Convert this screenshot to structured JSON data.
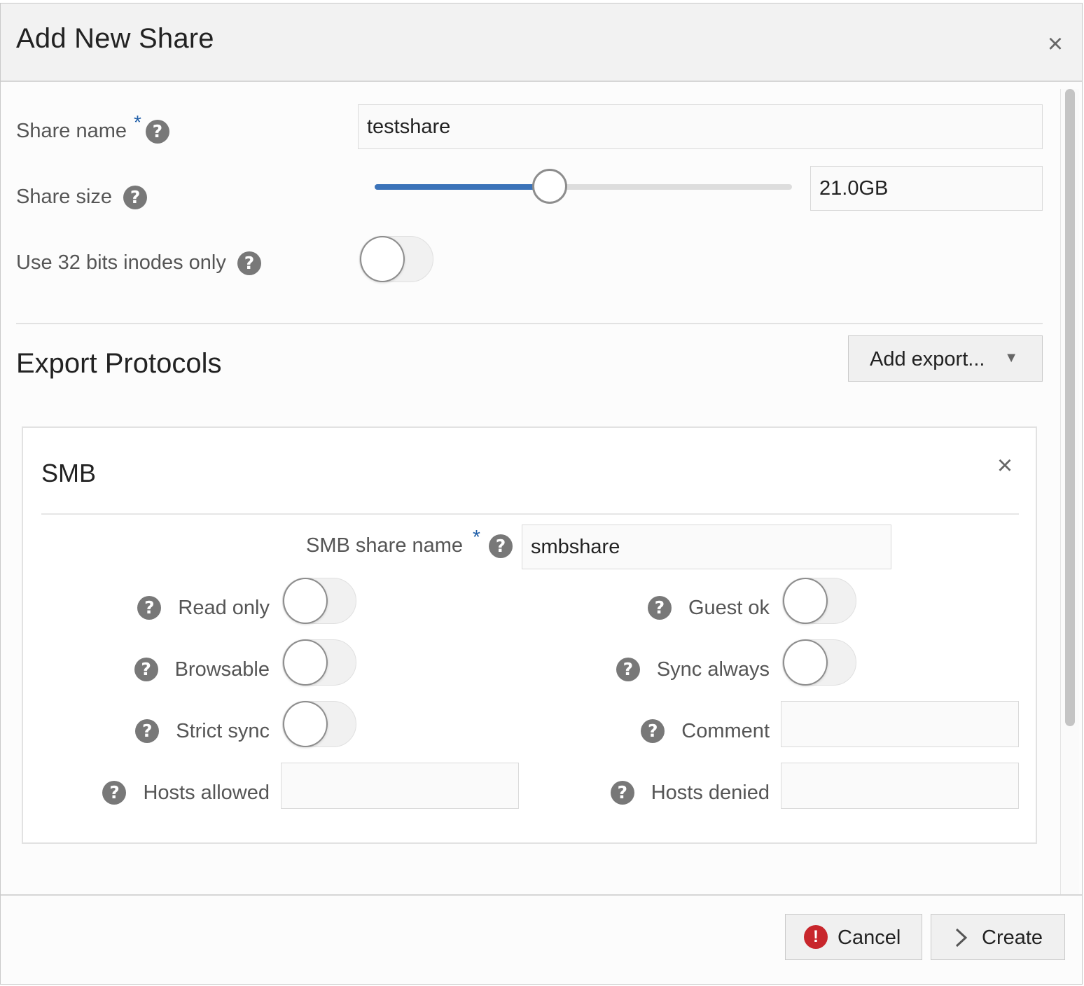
{
  "dialog": {
    "title": "Add New Share",
    "close_glyph": "×"
  },
  "form": {
    "share_name": {
      "label": "Share name",
      "required_mark": "*",
      "value": "testshare"
    },
    "share_size": {
      "label": "Share size",
      "value": "21.0GB",
      "slider_fraction": 0.42
    },
    "inodes32": {
      "label": "Use 32 bits inodes only",
      "on": false
    }
  },
  "export": {
    "title": "Export Protocols",
    "add_button_label": "Add export...",
    "add_button_caret": "▼"
  },
  "smb": {
    "title": "SMB",
    "close_glyph": "×",
    "share_name": {
      "label": "SMB share name",
      "required_mark": "*",
      "value": "smbshare"
    },
    "read_only": {
      "label": "Read only",
      "on": false
    },
    "browsable": {
      "label": "Browsable",
      "on": false
    },
    "strict_sync": {
      "label": "Strict sync",
      "on": false
    },
    "hosts_allowed": {
      "label": "Hosts allowed",
      "value": ""
    },
    "guest_ok": {
      "label": "Guest ok",
      "on": false
    },
    "sync_always": {
      "label": "Sync always",
      "on": false
    },
    "comment": {
      "label": "Comment",
      "value": ""
    },
    "hosts_denied": {
      "label": "Hosts denied",
      "value": ""
    }
  },
  "footer": {
    "cancel_label": "Cancel",
    "create_label": "Create"
  },
  "icons": {
    "help": "?",
    "help_icon": "help-icon",
    "cancel_icon": "exclamation-icon",
    "create_icon": "chevron-right-icon"
  },
  "colors": {
    "accent": "#3b73b9",
    "required": "#1f5ea8",
    "error": "#c8262c"
  }
}
